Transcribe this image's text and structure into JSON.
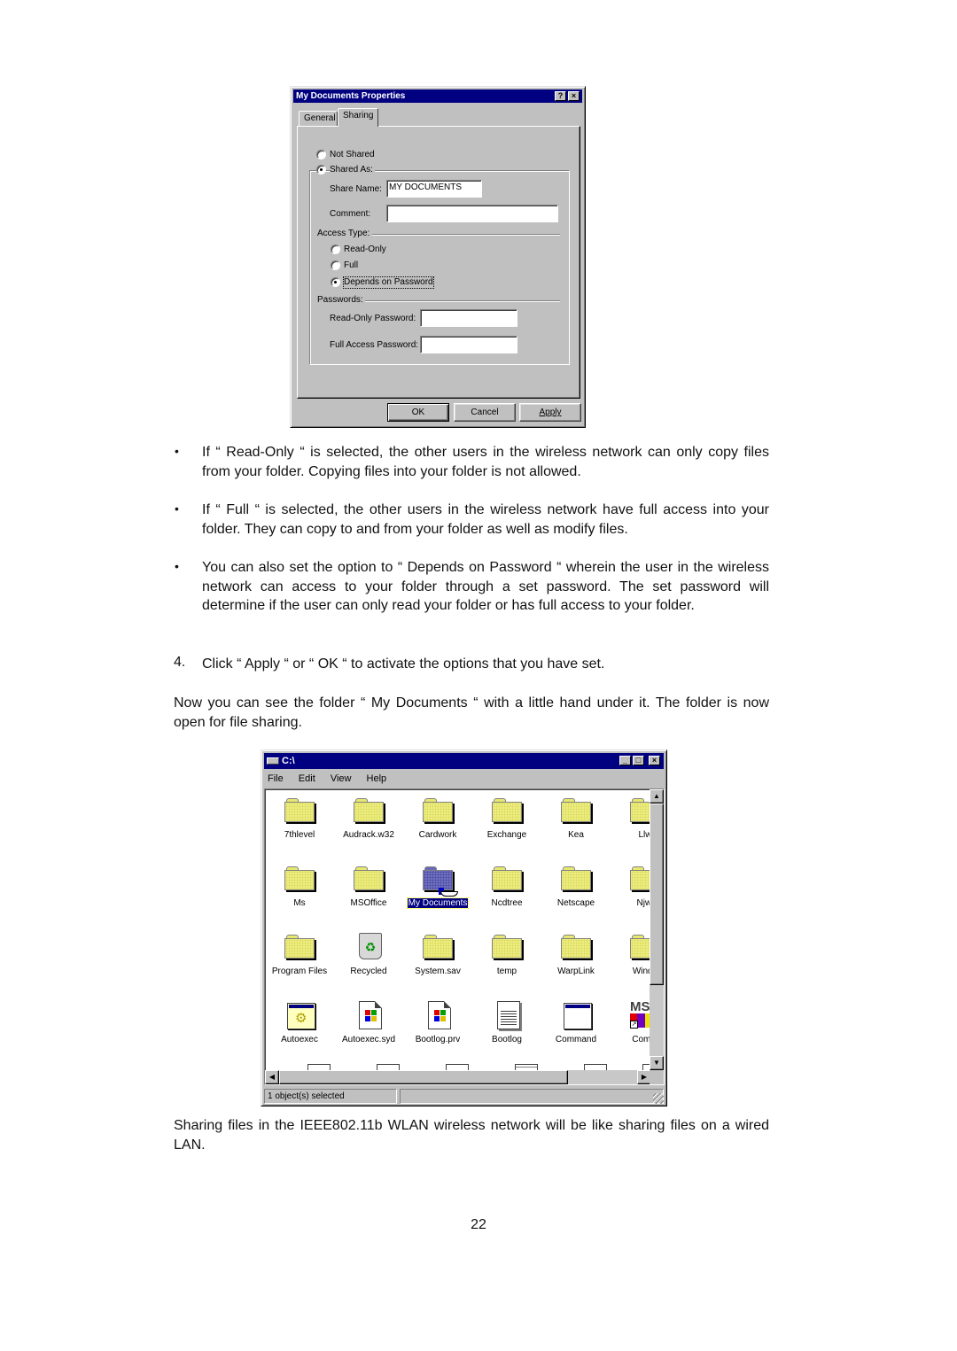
{
  "properties_dialog": {
    "title": "My Documents Properties",
    "help_button": "?",
    "close_button": "×",
    "tabs": [
      {
        "label": "General",
        "active": false
      },
      {
        "label": "Sharing",
        "active": true
      }
    ],
    "not_shared_label": "Not Shared",
    "shared_as_label": "Shared As:",
    "sharing_selected": "Shared As",
    "share_name_label": "Share Name:",
    "share_name_value": "MY DOCUMENTS",
    "comment_label": "Comment:",
    "comment_value": "",
    "access_type_label": "Access Type:",
    "access_options": [
      {
        "label": "Read-Only",
        "selected": false
      },
      {
        "label": "Full",
        "selected": false
      },
      {
        "label": "Depends on Password",
        "selected": true
      }
    ],
    "passwords_label": "Passwords:",
    "read_only_password_label": "Read-Only Password:",
    "read_only_password_value": "",
    "full_access_password_label": "Full Access Password:",
    "full_access_password_value": "",
    "buttons": {
      "ok": "OK",
      "cancel": "Cancel",
      "apply": "Apply"
    }
  },
  "text": {
    "bullet_1": "If “ Read-Only “ is selected, the other users in the wireless network can only copy files from your folder.  Copying files into your folder is not allowed.",
    "bullet_2": "If  “ Full “ is selected, the other users in the wireless network have full access into your folder.  They can copy to and from your folder as well as modify files.",
    "bullet_3": "You can also set the option to  “ Depends on Password “ wherein the user in the wireless network can access to your folder through a set password.  The set password will determine if the user can only read your folder or has full access to your folder.",
    "bullet_symbol": "•",
    "step_number": "4.",
    "step_4": "Click  “ Apply “ or  “ OK “ to activate the options that you have set.",
    "para_now": "Now you can see the folder  “ My Documents “ with a little hand under it.  The folder is now open for file sharing.",
    "para_sharing": "Sharing files in the IEEE802.11b WLAN wireless network will be like sharing files on a wired LAN.",
    "page_number": "22"
  },
  "explorer": {
    "title": "C:\\",
    "menu": [
      "File",
      "Edit",
      "View",
      "Help"
    ],
    "status": "1 object(s) selected",
    "items": [
      {
        "label": "7thlevel",
        "icon": "folder-icon"
      },
      {
        "label": "Audrack.w32",
        "icon": "folder-icon"
      },
      {
        "label": "Cardwork",
        "icon": "folder-icon"
      },
      {
        "label": "Exchange",
        "icon": "folder-icon"
      },
      {
        "label": "Kea",
        "icon": "folder-icon"
      },
      {
        "label": "Llw",
        "icon": "folder-icon"
      },
      {
        "label": "Ms",
        "icon": "folder-icon"
      },
      {
        "label": "MSOffice",
        "icon": "folder-icon"
      },
      {
        "label": "My Documents",
        "icon": "shared-folder-icon",
        "selected": true
      },
      {
        "label": "Ncdtree",
        "icon": "folder-icon"
      },
      {
        "label": "Netscape",
        "icon": "folder-icon"
      },
      {
        "label": "Njwi",
        "icon": "folder-icon"
      },
      {
        "label": "Program Files",
        "icon": "folder-icon"
      },
      {
        "label": "Recycled",
        "icon": "recycle-bin-icon"
      },
      {
        "label": "System.sav",
        "icon": "folder-icon"
      },
      {
        "label": "temp",
        "icon": "folder-icon"
      },
      {
        "label": "WarpLink",
        "icon": "folder-icon"
      },
      {
        "label": "Windo",
        "icon": "folder-icon"
      },
      {
        "label": "Autoexec",
        "icon": "config-file-icon"
      },
      {
        "label": "Autoexec.syd",
        "icon": "windows-file-icon"
      },
      {
        "label": "Bootlog.prv",
        "icon": "windows-file-icon"
      },
      {
        "label": "Bootlog",
        "icon": "text-file-icon"
      },
      {
        "label": "Command",
        "icon": "program-icon"
      },
      {
        "label": "Comm",
        "icon": "ms-shortcut-icon"
      }
    ]
  }
}
